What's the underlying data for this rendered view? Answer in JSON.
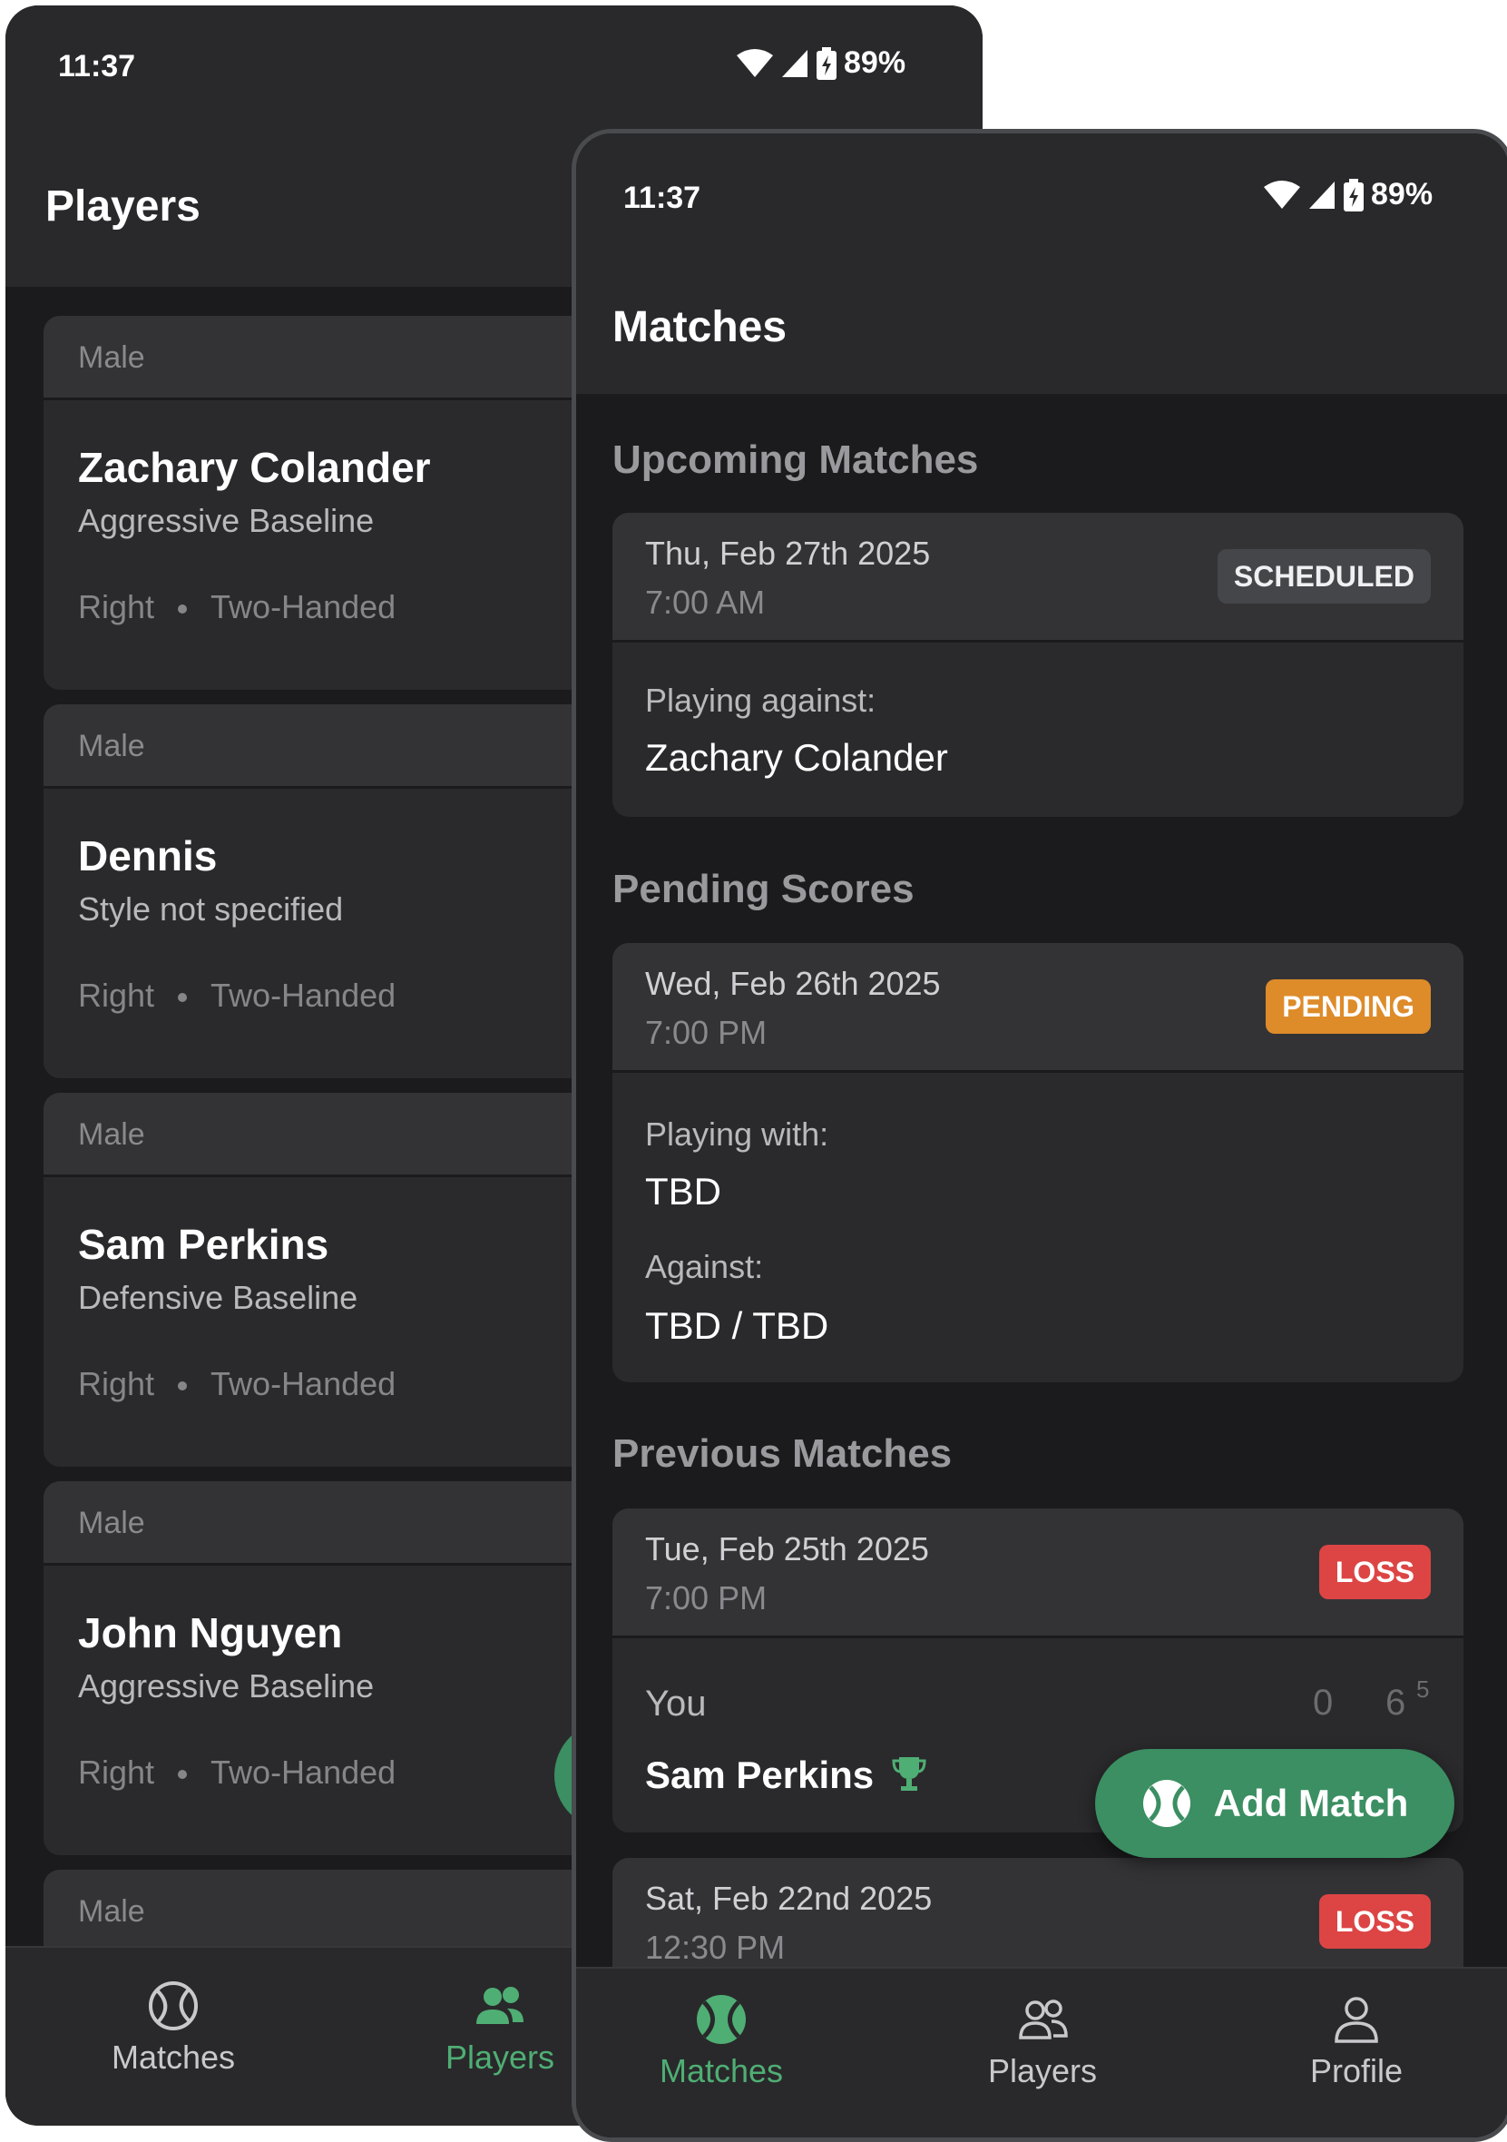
{
  "back_screen": {
    "status": {
      "time": "11:37",
      "battery": "89%"
    },
    "title": "Players",
    "players": [
      {
        "gender": "Male",
        "name": "Zachary Colander",
        "style": "Aggressive Baseline",
        "hand": "Right",
        "backhand": "Two-Handed"
      },
      {
        "gender": "Male",
        "name": "Dennis",
        "style": "Style not specified",
        "hand": "Right",
        "backhand": "Two-Handed"
      },
      {
        "gender": "Male",
        "name": "Sam Perkins",
        "style": "Defensive Baseline",
        "hand": "Right",
        "backhand": "Two-Handed"
      },
      {
        "gender": "Male",
        "name": "John Nguyen",
        "style": "Aggressive Baseline",
        "hand": "Right",
        "backhand": "Two-Handed"
      },
      {
        "gender": "Male",
        "name": "",
        "style": "",
        "hand": "",
        "backhand": ""
      }
    ],
    "nav": {
      "matches": "Matches",
      "players": "Players"
    }
  },
  "front_screen": {
    "status": {
      "time": "11:37",
      "battery": "89%"
    },
    "title": "Matches",
    "sections": {
      "upcoming": "Upcoming Matches",
      "pending": "Pending Scores",
      "previous": "Previous Matches"
    },
    "upcoming_match": {
      "date": "Thu, Feb 27th 2025",
      "time": "7:00 AM",
      "status": "SCHEDULED",
      "label": "Playing against:",
      "opponent": "Zachary Colander"
    },
    "pending_match": {
      "date": "Wed, Feb 26th 2025",
      "time": "7:00 PM",
      "status": "PENDING",
      "with_label": "Playing with:",
      "partner": "TBD",
      "against_label": "Against:",
      "opponents": "TBD / TBD"
    },
    "previous_matches": [
      {
        "date": "Tue, Feb 25th 2025",
        "time": "7:00 PM",
        "status": "LOSS",
        "you": "You",
        "opponent": "Sam Perkins",
        "score_set1": "0",
        "score_set2": "6",
        "tiebreak": "5"
      },
      {
        "date": "Sat, Feb 22nd 2025",
        "time": "12:30 PM",
        "status": "LOSS"
      }
    ],
    "fab_label": "Add Match",
    "nav": {
      "matches": "Matches",
      "players": "Players",
      "profile": "Profile"
    }
  },
  "colors": {
    "accent": "#4fae74",
    "pending": "#de8b2a",
    "loss": "#dd4545",
    "background": "#1b1b1d",
    "surface": "#2a2a2c"
  }
}
